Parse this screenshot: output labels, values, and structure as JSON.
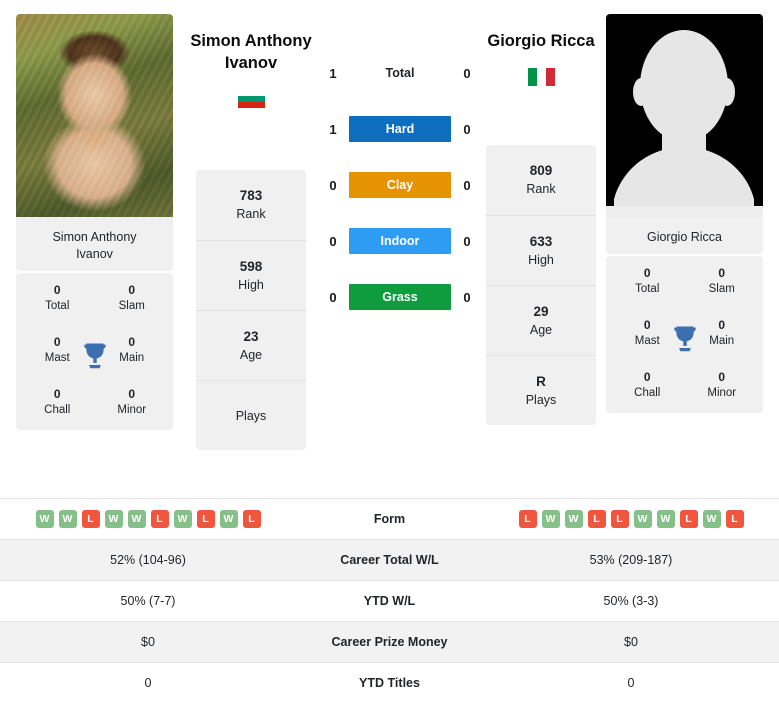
{
  "players": {
    "left": {
      "name": "Simon Anthony Ivanov",
      "name_line1": "Simon Anthony",
      "name_line2": "Ivanov",
      "photo_caption_line1": "Simon Anthony",
      "photo_caption_line2": "Ivanov",
      "flag": "bulgaria-flag",
      "rank": "783",
      "rank_label": "Rank",
      "high": "598",
      "high_label": "High",
      "age": "23",
      "age_label": "Age",
      "plays": "",
      "plays_label": "Plays",
      "titles": {
        "total": "0",
        "total_label": "Total",
        "slam": "0",
        "slam_label": "Slam",
        "mast": "0",
        "mast_label": "Mast",
        "main": "0",
        "main_label": "Main",
        "chall": "0",
        "chall_label": "Chall",
        "minor": "0",
        "minor_label": "Minor"
      },
      "form": [
        "W",
        "W",
        "L",
        "W",
        "W",
        "L",
        "W",
        "L",
        "W",
        "L"
      ],
      "career_wl": "52% (104-96)",
      "ytd_wl": "50% (7-7)",
      "career_prize": "$0",
      "ytd_titles": "0"
    },
    "right": {
      "name": "Giorgio Ricca",
      "name_line1": "Giorgio Ricca",
      "name_line2": "",
      "photo_caption_line1": "Giorgio Ricca",
      "photo_caption_line2": "",
      "flag": "italy-flag",
      "rank": "809",
      "rank_label": "Rank",
      "high": "633",
      "high_label": "High",
      "age": "29",
      "age_label": "Age",
      "plays": "R",
      "plays_label": "Plays",
      "titles": {
        "total": "0",
        "total_label": "Total",
        "slam": "0",
        "slam_label": "Slam",
        "mast": "0",
        "mast_label": "Mast",
        "main": "0",
        "main_label": "Main",
        "chall": "0",
        "chall_label": "Chall",
        "minor": "0",
        "minor_label": "Minor"
      },
      "form": [
        "L",
        "W",
        "W",
        "L",
        "L",
        "W",
        "W",
        "L",
        "W",
        "L"
      ],
      "career_wl": "53% (209-187)",
      "ytd_wl": "50% (3-3)",
      "career_prize": "$0",
      "ytd_titles": "0"
    }
  },
  "head_to_head": {
    "rows": [
      {
        "label": "Total",
        "left": "1",
        "right": "0",
        "color": "",
        "styled": false
      },
      {
        "label": "Hard",
        "left": "1",
        "right": "0",
        "color": "#0d6ec0",
        "styled": true
      },
      {
        "label": "Clay",
        "left": "0",
        "right": "0",
        "color": "#e59400",
        "styled": true
      },
      {
        "label": "Indoor",
        "left": "0",
        "right": "0",
        "color": "#2f9cf4",
        "styled": true
      },
      {
        "label": "Grass",
        "left": "0",
        "right": "0",
        "color": "#0f9c3f",
        "styled": true
      }
    ]
  },
  "table": {
    "rows": [
      {
        "label": "Form",
        "type": "form"
      },
      {
        "label": "Career Total W/L",
        "type": "text",
        "left": "52% (104-96)",
        "right": "53% (209-187)"
      },
      {
        "label": "YTD W/L",
        "type": "text",
        "left": "50% (7-7)",
        "right": "50% (3-3)"
      },
      {
        "label": "Career Prize Money",
        "type": "text",
        "left": "$0",
        "right": "$0"
      },
      {
        "label": "YTD Titles",
        "type": "text",
        "left": "0",
        "right": "0"
      }
    ]
  },
  "colors": {
    "hard": "#0d6ec0",
    "clay": "#e59400",
    "indoor": "#2f9cf4",
    "grass": "#0f9c3f",
    "win_chip": "#85c088",
    "loss_chip": "#f1563c",
    "trophy": "#3c6fb0",
    "card_bg": "#f0f0f0"
  }
}
